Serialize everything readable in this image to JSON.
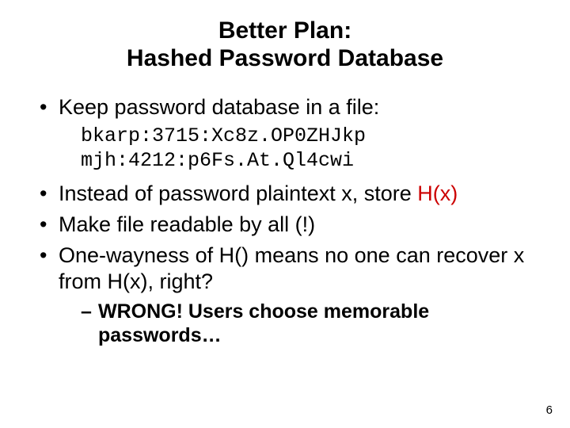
{
  "title_line1": "Better Plan:",
  "title_line2": "Hashed Password Database",
  "bullets": {
    "b1": "Keep password database in a file:",
    "code1": "bkarp:3715:Xc8z.OP0ZHJkp",
    "code2": "mjh:4212:p6Fs.At.Ql4cwi",
    "b2_pre": "Instead of password plaintext x, store ",
    "b2_hx": "H(x)",
    "b3": "Make file readable by all (!)",
    "b4": "One-wayness of H() means no one can recover x from H(x), right?",
    "sub1": "WRONG! Users choose memorable passwords…"
  },
  "page_number": "6"
}
